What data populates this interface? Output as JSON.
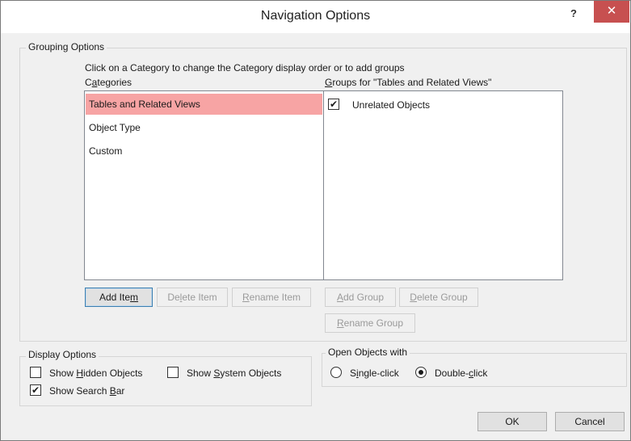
{
  "window": {
    "title": "Navigation Options",
    "help_label": "?",
    "close_label": "✕"
  },
  "grouping": {
    "legend": "Grouping Options",
    "instruction": "Click on a Category to change the Category display order or to add groups",
    "categories_label_pre": "C",
    "categories_label_ul": "a",
    "categories_label_post": "tegories",
    "groups_label_ul": "G",
    "groups_label_post": "roups for \"Tables and Related Views\"",
    "categories": [
      {
        "label": "Tables and Related Views",
        "selected": true
      },
      {
        "label": "Object Type",
        "selected": false
      },
      {
        "label": "Custom",
        "selected": false
      }
    ],
    "groups": [
      {
        "label": "Unrelated Objects",
        "checked": true
      }
    ],
    "buttons": {
      "add_item_pre": "Add Ite",
      "add_item_ul": "m",
      "delete_item_pre": "De",
      "delete_item_ul": "l",
      "delete_item_post": "ete Item",
      "rename_item_ul": "R",
      "rename_item_post": "ename Item",
      "add_group_ul": "A",
      "add_group_post": "dd Group",
      "delete_group_ul": "D",
      "delete_group_post": "elete Group",
      "rename_group_ul": "R",
      "rename_group_post": "ename Group"
    }
  },
  "display": {
    "legend": "Display Options",
    "show_hidden_pre": "Show ",
    "show_hidden_ul": "H",
    "show_hidden_post": "idden Objects",
    "show_hidden_checked": false,
    "show_system_pre": "Show ",
    "show_system_ul": "S",
    "show_system_post": "ystem Objects",
    "show_system_checked": false,
    "show_search_pre": "Show Search ",
    "show_search_ul": "B",
    "show_search_post": "ar",
    "show_search_checked": true
  },
  "open_objects": {
    "legend": "Open Objects with",
    "single_pre": "S",
    "single_ul": "i",
    "single_post": "ngle-click",
    "double_pre": "Double-",
    "double_ul": "c",
    "double_post": "lick",
    "selected": "double"
  },
  "footer": {
    "ok_label": "OK",
    "cancel_label": "Cancel"
  },
  "colors": {
    "selected_row": "#f7a4a4",
    "close_button": "#c75050"
  }
}
